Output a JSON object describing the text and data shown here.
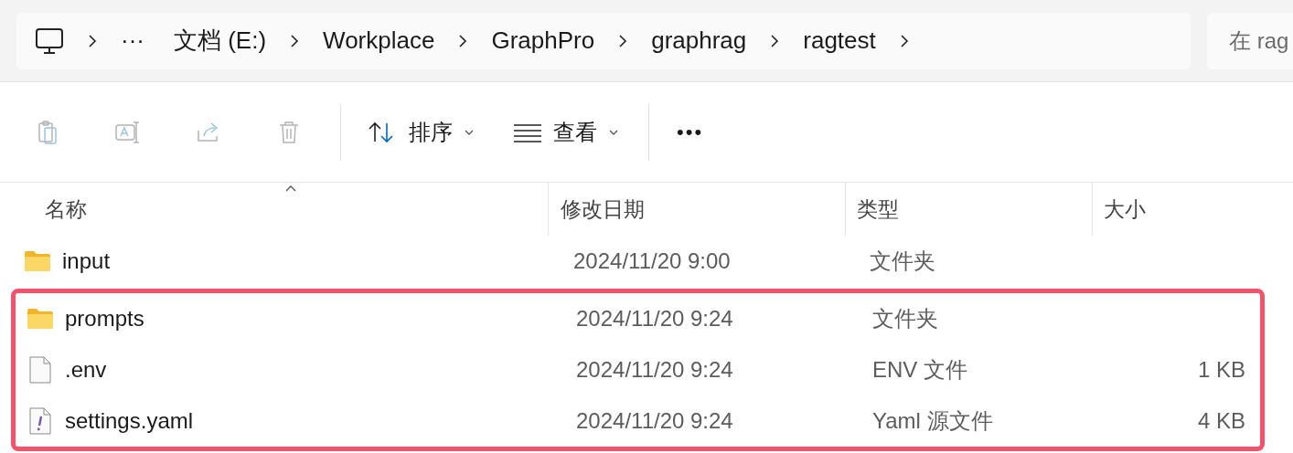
{
  "breadcrumb": {
    "overflow": "···",
    "items": [
      "文档 (E:)",
      "Workplace",
      "GraphPro",
      "graphrag",
      "ragtest"
    ]
  },
  "search": {
    "placeholder": "在 rag"
  },
  "toolbar": {
    "actions": [
      {
        "kind": "paste",
        "disabled": true
      },
      {
        "kind": "rename",
        "disabled": true
      },
      {
        "kind": "share",
        "disabled": true
      },
      {
        "kind": "delete",
        "disabled": true
      }
    ],
    "menus": [
      {
        "kind": "sort",
        "label": "排序"
      },
      {
        "kind": "view",
        "label": "查看"
      }
    ],
    "more": "•••"
  },
  "table": {
    "columns": [
      {
        "label": "名称",
        "sorted": true
      },
      {
        "label": "修改日期",
        "sorted": false
      },
      {
        "label": "类型",
        "sorted": false
      },
      {
        "label": "大小",
        "sorted": false
      }
    ],
    "rows": [
      {
        "kind": "folder",
        "name": "input",
        "modified": "2024/11/20 9:00",
        "type": "文件夹",
        "highlighted": false
      },
      {
        "kind": "folder",
        "name": "prompts",
        "modified": "2024/11/20 9:24",
        "type": "文件夹",
        "highlighted": true
      },
      {
        "kind": "file",
        "name": ".env",
        "modified": "2024/11/20 9:24",
        "type": "ENV 文件",
        "size": "1 KB",
        "highlighted": true
      },
      {
        "kind": "yaml",
        "name": "settings.yaml",
        "modified": "2024/11/20 9:24",
        "type": "Yaml 源文件",
        "size": "4 KB",
        "highlighted": true
      }
    ]
  }
}
